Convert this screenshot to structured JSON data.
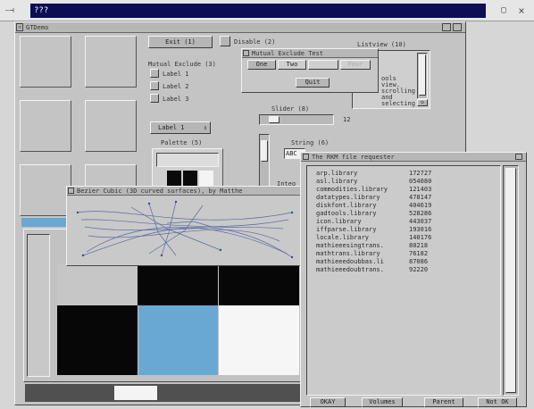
{
  "host": {
    "title": "???",
    "win_close": "×",
    "win_restore": "▢"
  },
  "main": {
    "title": "GTDemo",
    "exit_label": "Exit (1)",
    "disable_label": "Disable (2)",
    "mx_title": "Mutual Exclude (3)",
    "mx_labels": [
      "Label 1",
      "Label 2",
      "Label 3"
    ],
    "cycle_value": "Label 1",
    "palette_title": "Palette (5)",
    "slider_title": "Slider (8)",
    "slider_value": "12",
    "slider_level": 0.12,
    "string_title": "String (6)",
    "string_value": "ABC",
    "listview_title": "Listview (10)",
    "listview_items": [
      "ools",
      "view.",
      "scrolling",
      "and",
      "selecting"
    ],
    "integer_label": "Integ"
  },
  "mx_test": {
    "title": "Mutual Exclude Test",
    "options": [
      "One",
      "Two",
      "Three",
      "Four"
    ],
    "quit_label": "Quit"
  },
  "bezier": {
    "title": "Bezier Cubic (3D curved surfaces), by Matthe"
  },
  "requester": {
    "title": "The RKM file requester",
    "files": [
      {
        "name": "arp.library",
        "size": "172727"
      },
      {
        "name": "asl.library",
        "size": "054080"
      },
      {
        "name": "commodities.library",
        "size": "121403"
      },
      {
        "name": "datatypes.library",
        "size": "478147"
      },
      {
        "name": "diskfont.library",
        "size": "404619"
      },
      {
        "name": "gadtools.library",
        "size": "528286"
      },
      {
        "name": "icon.library",
        "size": "443037"
      },
      {
        "name": "iffparse.library",
        "size": "193016"
      },
      {
        "name": "locale.library",
        "size": "140176"
      },
      {
        "name": "mathieeesingtrans.",
        "size": "80218"
      },
      {
        "name": "mathtrans.library",
        "size": "76182"
      },
      {
        "name": "mathieeedoubbas.li",
        "size": "87086"
      },
      {
        "name": "mathieeedoubtrans.",
        "size": "92220"
      }
    ],
    "okay_label": "OKAY",
    "volumes_label": "Volumes",
    "parent_label": "Parent",
    "notok_label": "Not OK"
  },
  "colors": {
    "title_active": "#0d0d55",
    "palette_blue": "#6aa8d4",
    "background": "#d6d6d6"
  }
}
